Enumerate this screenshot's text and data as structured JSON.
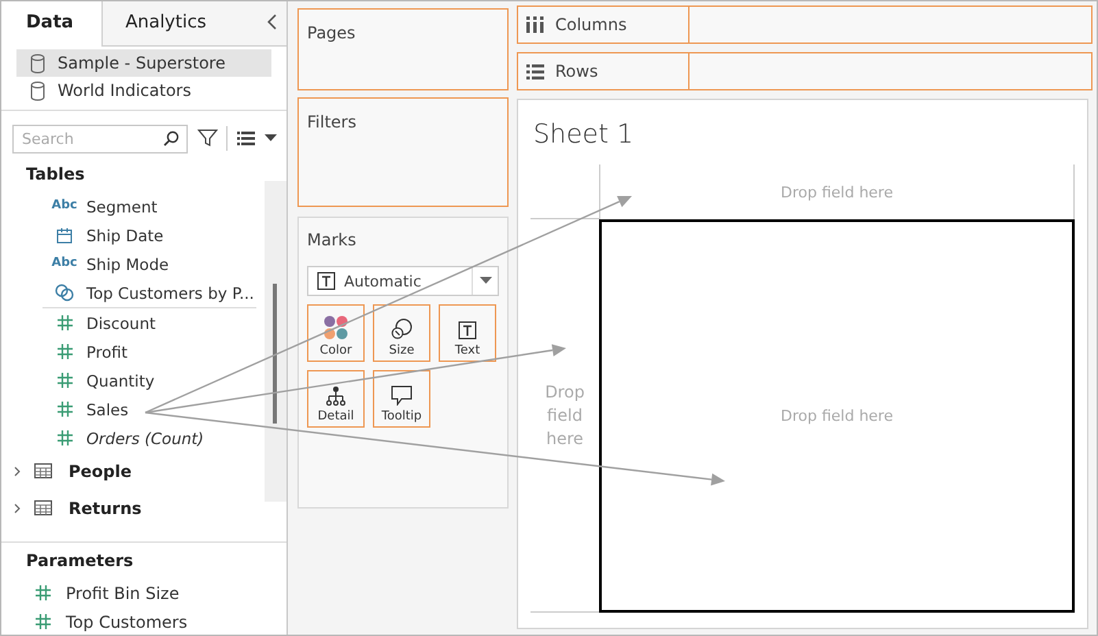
{
  "sidebar": {
    "tabs": [
      {
        "label": "Data",
        "selected": true
      },
      {
        "label": "Analytics",
        "selected": false
      }
    ],
    "data_sources": [
      {
        "name": "Sample - Superstore",
        "selected": true
      },
      {
        "name": "World Indicators",
        "selected": false
      }
    ],
    "search": {
      "placeholder": "Search"
    },
    "tables_heading": "Tables",
    "fields": [
      {
        "kind": "dimension",
        "badge": "Abc",
        "name": "Segment"
      },
      {
        "kind": "date",
        "name": "Ship Date"
      },
      {
        "kind": "dimension",
        "badge": "Abc",
        "name": "Ship Mode"
      },
      {
        "kind": "set",
        "name": "Top Customers by P..."
      },
      {
        "kind": "measure",
        "name": "Discount"
      },
      {
        "kind": "measure",
        "name": "Profit"
      },
      {
        "kind": "measure",
        "name": "Quantity"
      },
      {
        "kind": "measure",
        "name": "Sales"
      },
      {
        "kind": "measure",
        "name": "Orders (Count)",
        "italic": true
      }
    ],
    "tables": [
      {
        "name": "People",
        "expanded": false
      },
      {
        "name": "Returns",
        "expanded": false
      }
    ],
    "parameters_heading": "Parameters",
    "parameters": [
      {
        "name": "Profit Bin Size"
      },
      {
        "name": "Top Customers"
      }
    ]
  },
  "shelves": {
    "pages": "Pages",
    "filters": "Filters",
    "columns": "Columns",
    "rows": "Rows"
  },
  "marks": {
    "title": "Marks",
    "mark_type": "Automatic",
    "cards": [
      {
        "kind": "color",
        "label": "Color"
      },
      {
        "kind": "size",
        "label": "Size"
      },
      {
        "kind": "text",
        "label": "Text"
      },
      {
        "kind": "detail",
        "label": "Detail"
      },
      {
        "kind": "tooltip",
        "label": "Tooltip"
      }
    ]
  },
  "sheet": {
    "title": "Sheet 1",
    "columns_drop": "Drop field here",
    "rows_drop": "Drop field here",
    "body_drop": "Drop field here"
  }
}
